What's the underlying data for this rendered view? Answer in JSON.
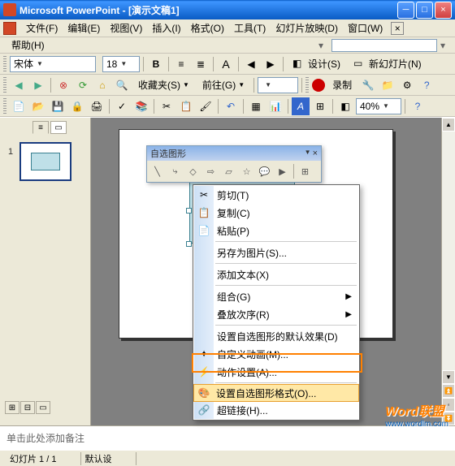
{
  "title": "Microsoft PowerPoint - [演示文稿1]",
  "menus": {
    "file": "文件(F)",
    "edit": "编辑(E)",
    "view": "视图(V)",
    "insert": "插入(I)",
    "format": "格式(O)",
    "tools": "工具(T)",
    "slideshow": "幻灯片放映(D)",
    "window": "窗口(W)",
    "help": "帮助(H)"
  },
  "format_toolbar": {
    "font_name": "宋体",
    "font_size": "18",
    "design_label": "设计(S)",
    "new_slide_label": "新幻灯片(N)"
  },
  "web_toolbar": {
    "favorites_label": "收藏夹(S)",
    "go_label": "前往(G)"
  },
  "record_toolbar": {
    "record_label": "录制"
  },
  "zoom": "40%",
  "autoshape_toolbar": {
    "title": "自选图形"
  },
  "context_menu": {
    "cut": "剪切(T)",
    "copy": "复制(C)",
    "paste": "粘贴(P)",
    "save_as_picture": "另存为图片(S)...",
    "add_text": "添加文本(X)",
    "group": "组合(G)",
    "order": "叠放次序(R)",
    "action_defaults": "设置自选图形的默认效果(D)",
    "custom_animation": "自定义动画(M)...",
    "action_settings": "动作设置(A)...",
    "format_autoshape": "设置自选图形格式(O)...",
    "hyperlink": "超链接(H)..."
  },
  "thumbnails": {
    "slide1_num": "1"
  },
  "notes_placeholder": "单击此处添加备注",
  "status": {
    "slide_indicator": "幻灯片 1 / 1",
    "layout": "默认设"
  },
  "watermark": {
    "brand": "Word联盟",
    "url": "www.wordlm.com"
  },
  "colors": {
    "titlebar": "#0a5bc4",
    "highlight_border": "#ff8000",
    "menu_highlight": "#ffe8a6",
    "shape_fill": "#bfe0e8"
  }
}
